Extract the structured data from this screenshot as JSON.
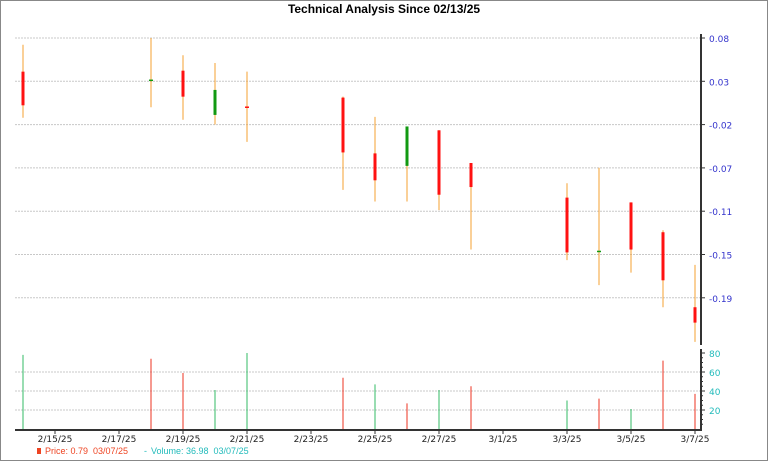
{
  "chart_data": {
    "type": "candlestick",
    "title": "Technical Analysis Since 02/13/25",
    "x_tick_labels": [
      "2/15/25",
      "2/17/25",
      "2/19/25",
      "2/21/25",
      "2/23/25",
      "2/25/25",
      "2/27/25",
      "3/1/25",
      "3/3/25",
      "3/5/25",
      "3/7/25"
    ],
    "x_tick_days": [
      1,
      3,
      5,
      7,
      9,
      11,
      13,
      15,
      17,
      19,
      21
    ],
    "price_axis": {
      "ticks": [
        "0.08",
        "0.03",
        "-0.02",
        "-0.07",
        "-0.11",
        "-0.15",
        "-0.19"
      ],
      "range": [
        -0.24,
        0.08
      ]
    },
    "volume_axis": {
      "ticks": [
        "80",
        "60",
        "40",
        "20"
      ],
      "range": [
        0,
        80
      ]
    },
    "candles": [
      {
        "date": "2/14/25",
        "day": 0,
        "open": 0.045,
        "high": 0.073,
        "low": -0.003,
        "close": 0.01,
        "volume": 78,
        "vol_color": "green"
      },
      {
        "date": "2/18/25",
        "day": 4,
        "open": 0.036,
        "high": 0.08,
        "low": 0.008,
        "close": 0.036,
        "volume": 74,
        "vol_color": "red",
        "doji": "green"
      },
      {
        "date": "2/19/25",
        "day": 5,
        "open": 0.046,
        "high": 0.062,
        "low": -0.005,
        "close": 0.019,
        "volume": 59,
        "vol_color": "red"
      },
      {
        "date": "2/20/25",
        "day": 6,
        "open": 0.0,
        "high": 0.054,
        "low": -0.01,
        "close": 0.026,
        "volume": 41,
        "vol_color": "green"
      },
      {
        "date": "2/21/25",
        "day": 7,
        "open": 0.008,
        "high": 0.045,
        "low": -0.028,
        "close": 0.008,
        "volume": 80,
        "vol_color": "green",
        "doji": "red"
      },
      {
        "date": "2/24/25",
        "day": 10,
        "open": 0.018,
        "high": 0.019,
        "low": -0.078,
        "close": -0.039,
        "volume": 54,
        "vol_color": "red"
      },
      {
        "date": "2/25/25",
        "day": 11,
        "open": -0.04,
        "high": -0.002,
        "low": -0.09,
        "close": -0.068,
        "volume": 47,
        "vol_color": "green"
      },
      {
        "date": "2/26/25",
        "day": 12,
        "open": -0.053,
        "high": -0.012,
        "low": -0.09,
        "close": -0.012,
        "volume": 27,
        "vol_color": "red"
      },
      {
        "date": "2/27/25",
        "day": 13,
        "open": -0.016,
        "high": -0.016,
        "low": -0.099,
        "close": -0.083,
        "volume": 41,
        "vol_color": "green"
      },
      {
        "date": "2/28/25",
        "day": 14,
        "open": -0.05,
        "high": -0.05,
        "low": -0.14,
        "close": -0.075,
        "volume": 45,
        "vol_color": "red"
      },
      {
        "date": "3/3/25",
        "day": 17,
        "open": -0.086,
        "high": -0.071,
        "low": -0.151,
        "close": -0.143,
        "volume": 30,
        "vol_color": "green"
      },
      {
        "date": "3/4/25",
        "day": 18,
        "open": -0.142,
        "high": -0.055,
        "low": -0.177,
        "close": -0.142,
        "volume": 32,
        "vol_color": "red",
        "doji": "green"
      },
      {
        "date": "3/5/25",
        "day": 19,
        "open": -0.091,
        "high": -0.091,
        "low": -0.164,
        "close": -0.14,
        "volume": 21,
        "vol_color": "green"
      },
      {
        "date": "3/6/25",
        "day": 20,
        "open": -0.122,
        "high": -0.12,
        "low": -0.2,
        "close": -0.172,
        "volume": 72,
        "vol_color": "red"
      },
      {
        "date": "3/7/25",
        "day": 21,
        "open": -0.2,
        "high": -0.156,
        "low": -0.236,
        "close": -0.216,
        "volume": 37,
        "vol_color": "red"
      }
    ],
    "legend": {
      "price": "Price: 0.79  03/07/25",
      "volume": "Volume: 36.98  03/07/25"
    },
    "grid": true
  },
  "colors": {
    "up": "#119911",
    "down": "#ff1111",
    "wick": "#f5a030",
    "vol_up": "#33bb66",
    "vol_down": "#ee3322",
    "price_axis": "#3333cc",
    "vol_axis": "#22bbbb",
    "legend_price": "#ee4422",
    "legend_volume": "#22bbbb"
  }
}
